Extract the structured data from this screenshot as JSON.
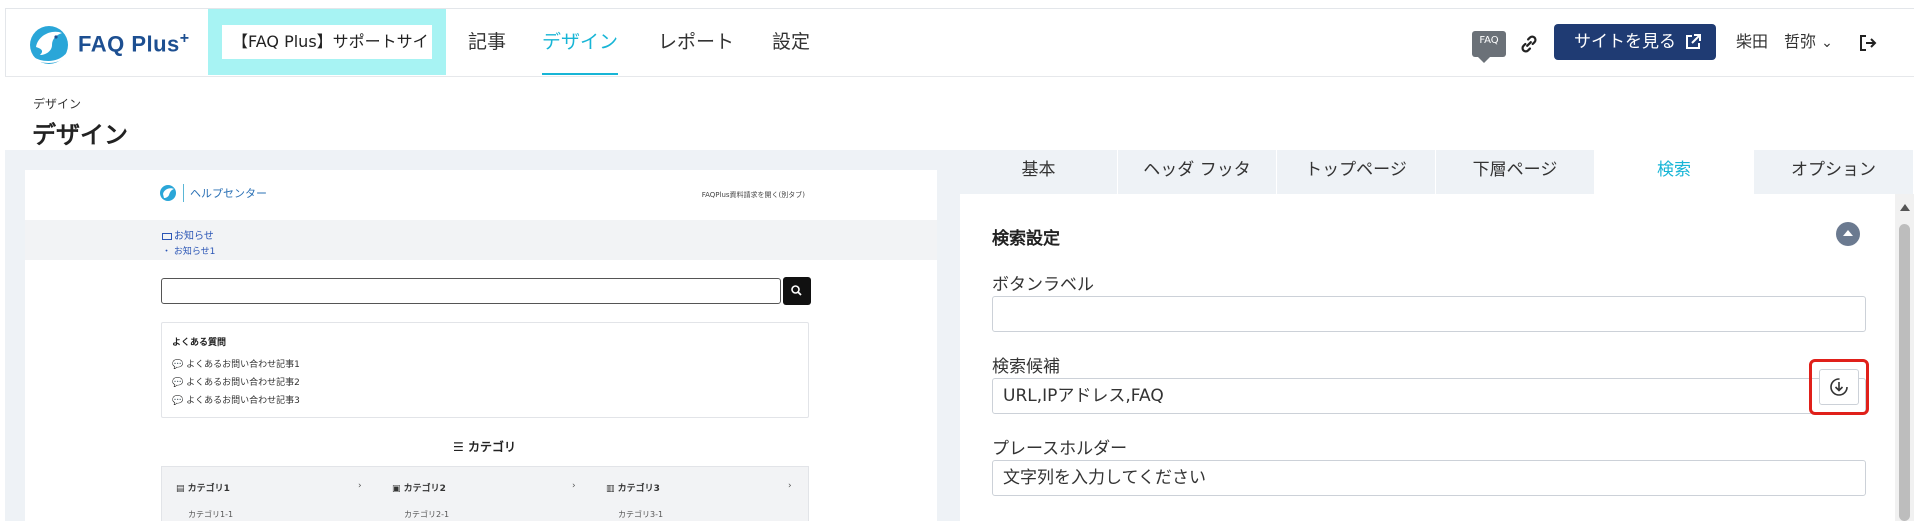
{
  "header": {
    "logo_text": "FAQ Plus",
    "logo_plus": "+",
    "site_name": "【FAQ Plus】サポートサイト",
    "nav": [
      "記事",
      "デザイン",
      "レポート",
      "設定"
    ],
    "active_nav": "デザイン",
    "faq_badge": "FAQ",
    "view_site_label": "サイトを見る",
    "user_name": "柴田　哲弥",
    "user_chevron": "⌄"
  },
  "page": {
    "breadcrumb": "デザイン",
    "title": "デザイン"
  },
  "preview": {
    "site_label": "ヘルプセンター",
    "top_right_link": "FAQPlus資料請求を開く(別タブ)",
    "news_title": "お知らせ",
    "news_item": "・ お知らせ1",
    "faq_title": "よくある質問",
    "faq_items": [
      "よくあるお問い合わせ記事1",
      "よくあるお問い合わせ記事2",
      "よくあるお問い合わせ記事3"
    ],
    "category_title": "カテゴリ",
    "categories": [
      {
        "name": "カテゴリ1",
        "sub": "カテゴリ1-1"
      },
      {
        "name": "カテゴリ2",
        "sub": "カテゴリ2-1"
      },
      {
        "name": "カテゴリ3",
        "sub": "カテゴリ3-1"
      }
    ],
    "category_arrow": "›"
  },
  "settings": {
    "tabs": [
      "基本",
      "ヘッダ フッタ",
      "トップページ",
      "下層ページ",
      "検索",
      "オプション"
    ],
    "active_tab": "検索",
    "section_title": "検索設定",
    "fields": {
      "button_label": {
        "label": "ボタンラベル",
        "value": ""
      },
      "suggestions": {
        "label": "検索候補",
        "value": "URL,IPアドレス,FAQ"
      },
      "placeholder": {
        "label": "プレースホルダー",
        "value": "文字列を入力してください"
      }
    }
  },
  "colors": {
    "accent": "#17b5d6",
    "primary_button": "#1f3b73",
    "highlight_box": "#a7f3f3",
    "highlight_border": "#e0201a"
  }
}
